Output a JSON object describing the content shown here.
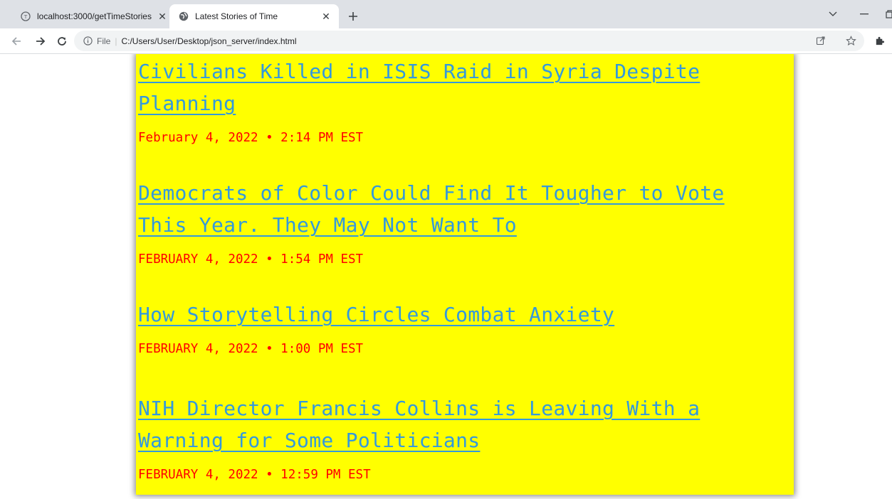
{
  "browser": {
    "tabs": [
      {
        "title": "localhost:3000/getTimeStories",
        "active": false
      },
      {
        "title": "Latest Stories of Time",
        "active": true
      }
    ],
    "address": {
      "scheme_label": "File",
      "url": "C:/Users/User/Desktop/json_server/index.html"
    }
  },
  "colors": {
    "page_background": "#ffff00",
    "link": "#3399dd",
    "date": "#ff0000",
    "tabstrip": "#dee1e6"
  },
  "stories": [
    {
      "title_lines": [
        "Civilians Killed in ISIS Raid in Syria Despite",
        "Planning"
      ],
      "date": "February 4, 2022 • 2:14 PM EST"
    },
    {
      "title_lines": [
        "Democrats of Color Could Find It Tougher to Vote",
        "This Year. They May Not Want To"
      ],
      "date": "FEBRUARY 4, 2022 • 1:54 PM EST"
    },
    {
      "title_lines": [
        "How Storytelling Circles Combat Anxiety"
      ],
      "date": "FEBRUARY 4, 2022 • 1:00 PM EST"
    },
    {
      "title_lines": [
        "NIH Director Francis Collins is Leaving With a",
        "Warning for Some Politicians"
      ],
      "date": "FEBRUARY 4, 2022 • 12:59 PM EST"
    }
  ]
}
